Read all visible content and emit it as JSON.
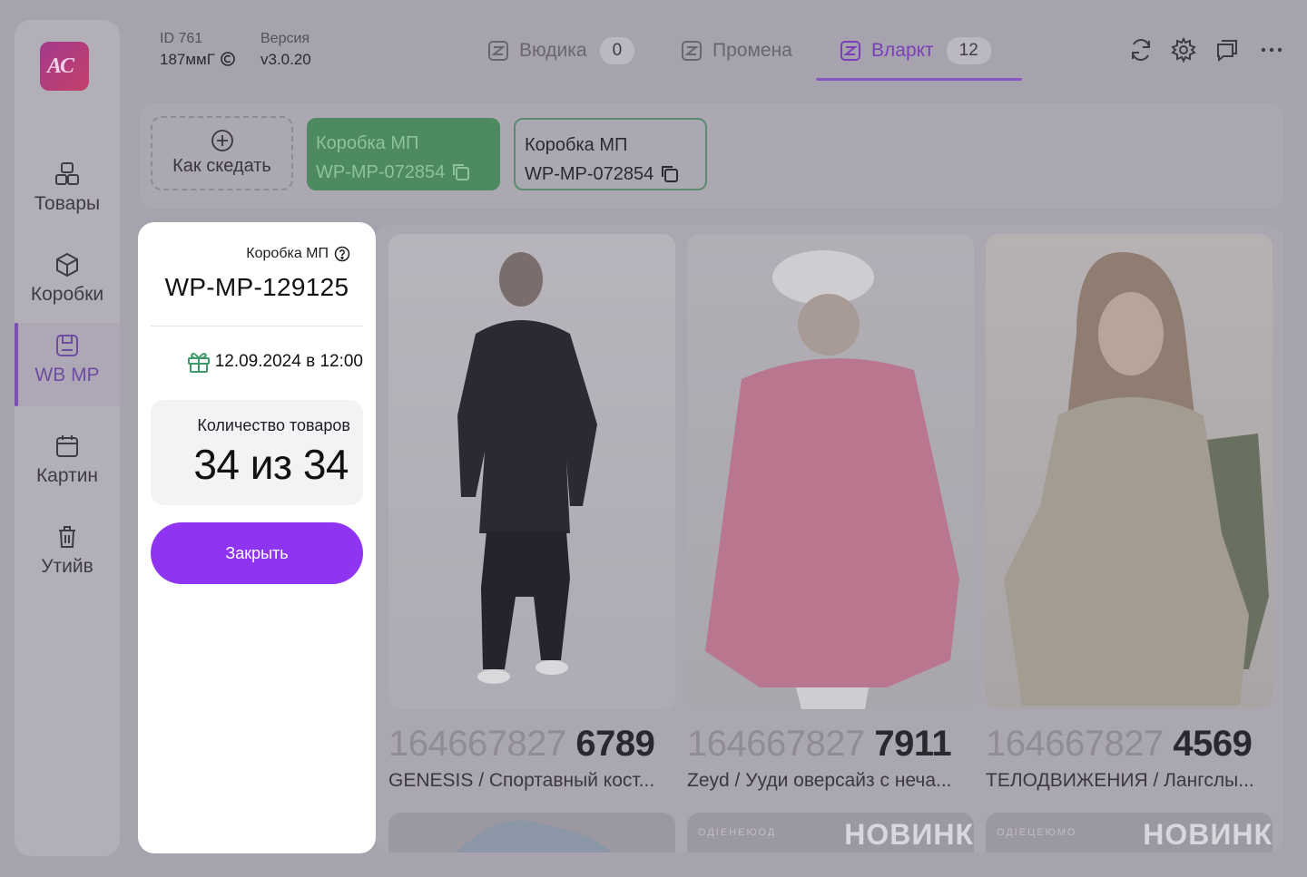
{
  "sidebar": {
    "logo_text": "AC",
    "items": [
      {
        "label": "Товары",
        "icon": "shapes-icon"
      },
      {
        "label": "Коробки",
        "icon": "box-icon"
      },
      {
        "label": "WB MP",
        "icon": "save-box-icon",
        "active": true
      },
      {
        "label": "Картин",
        "icon": "calendar-icon"
      },
      {
        "label": "Утийв",
        "icon": "trash-icon"
      }
    ]
  },
  "header": {
    "id_label": "ID 761",
    "id_value": "187ммГ",
    "version_label": "Версия",
    "version_value": "v3.0.20",
    "tabs": [
      {
        "label": "Вюдика",
        "count": "0"
      },
      {
        "label": "Промена",
        "count": ""
      },
      {
        "label": "Вларкт",
        "count": "12",
        "active": true
      }
    ],
    "tools": [
      "refresh-icon",
      "settings-icon",
      "chat-icon",
      "more-icon"
    ]
  },
  "boxes_bar": {
    "add_label": "Как скедать",
    "chips": [
      {
        "title": "Коробка МП",
        "code": "WP-MP-072854"
      },
      {
        "title": "Коробка МП",
        "code": "WP-MP-072854"
      }
    ]
  },
  "products": [
    {
      "sku_prefix": "164667827",
      "sku_suffix": "6789",
      "name": "GENESIS / Спортавный кост..."
    },
    {
      "sku_prefix": "164667827",
      "sku_suffix": "7911",
      "name": "Zeyd / Ууди оверсайз с неча..."
    },
    {
      "sku_prefix": "164667827",
      "sku_suffix": "4569",
      "name": "ТЕЛОДВИЖЕНИЯ / Лангслы..."
    }
  ],
  "more_products": [
    {
      "badge": ""
    },
    {
      "badge": "НОВИНК",
      "tag": "ОДІЕНЕЮОД"
    },
    {
      "badge": "НОВИНК",
      "tag": "ОДІЕЦЕЮМО"
    }
  ],
  "popup": {
    "label": "Коробка МП",
    "code": "WP-MP-129125",
    "date": "12.09.2024 в 12:00",
    "count_label": "Количество товаров",
    "count_value": "34 из 34",
    "close_label": "Закрыть"
  },
  "colors": {
    "accent": "#8f34f0",
    "green_chip": "#4e8a5f",
    "overlay": "#a7a3ae"
  }
}
